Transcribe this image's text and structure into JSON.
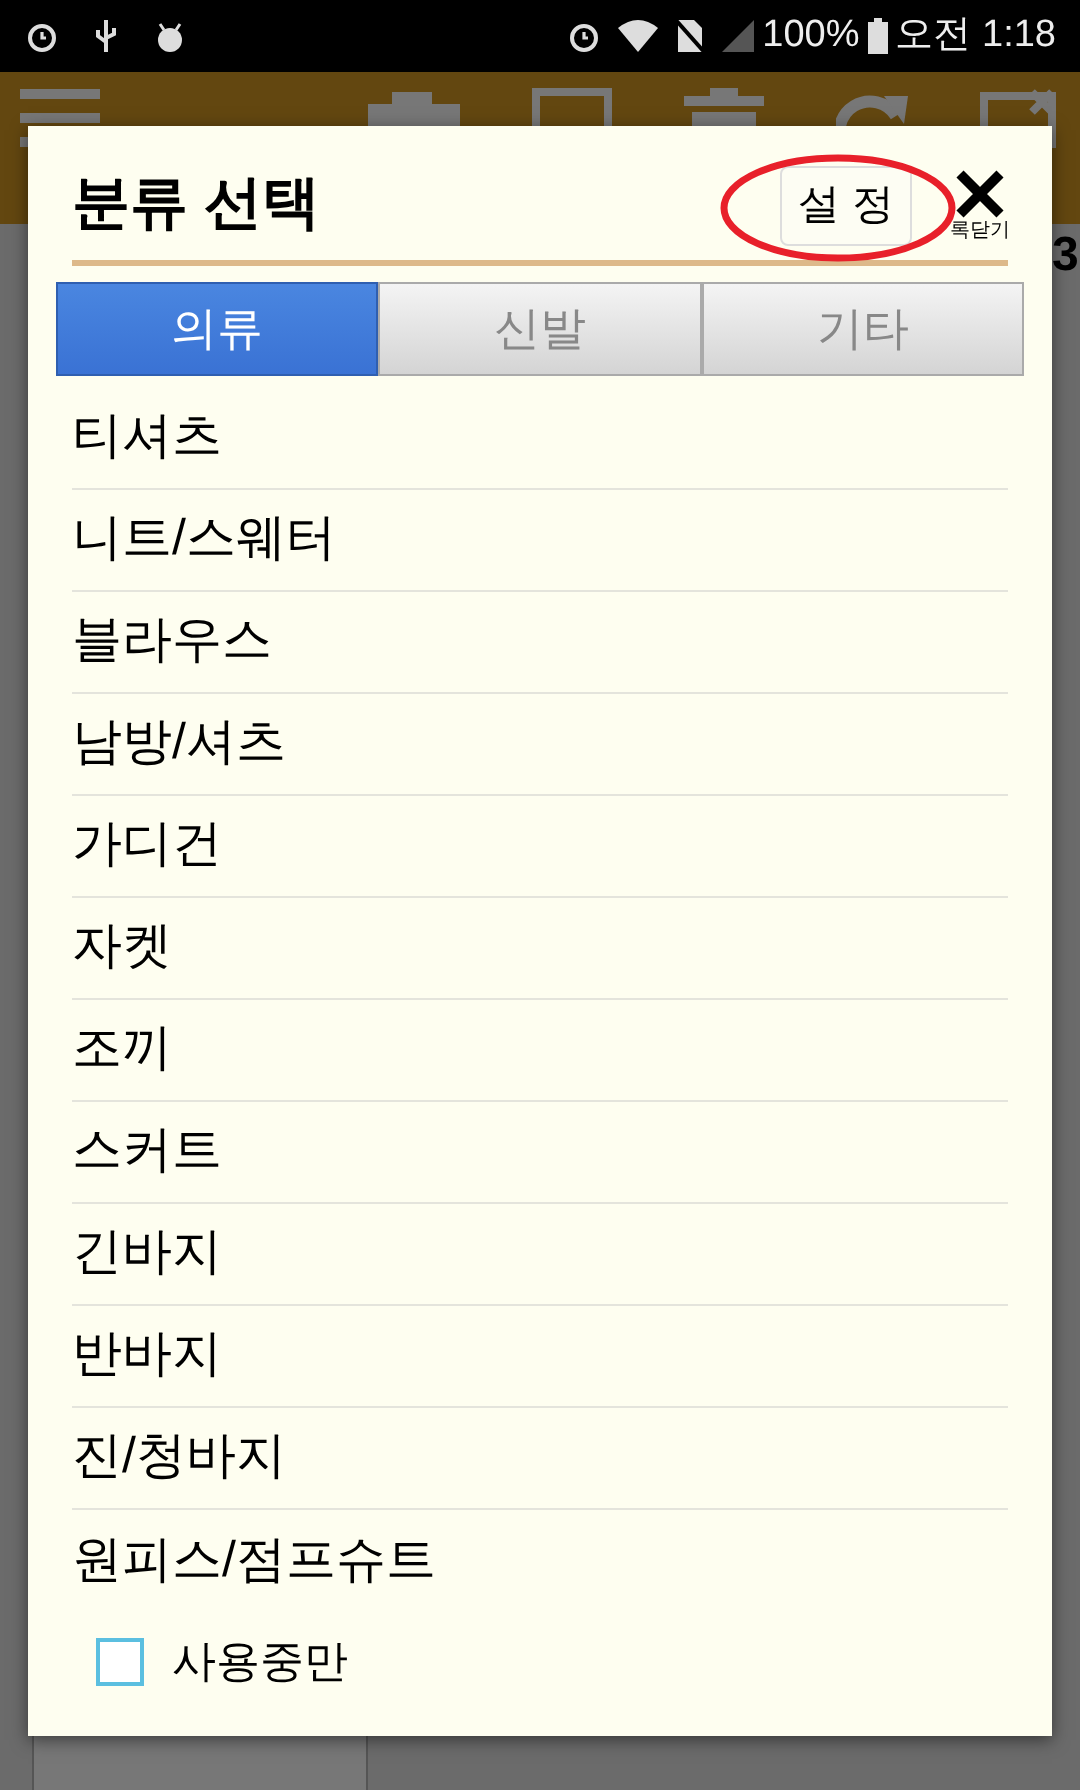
{
  "status_bar": {
    "battery": "100%",
    "time": "오전 1:18"
  },
  "background": {
    "edge_text": "3"
  },
  "dialog": {
    "title": "분류 선택",
    "settings_button": "설 정",
    "close_label": "록닫기",
    "tabs": [
      {
        "label": "의류",
        "selected": true
      },
      {
        "label": "신발",
        "selected": false
      },
      {
        "label": "기타",
        "selected": false
      }
    ],
    "items": [
      "티셔츠",
      "니트/스웨터",
      "블라우스",
      "남방/셔츠",
      "가디건",
      "자켓",
      "조끼",
      "스커트",
      "긴바지",
      "반바지",
      "진/청바지",
      "원피스/점프슈트"
    ],
    "in_use_only": {
      "label": "사용중만",
      "checked": false
    }
  }
}
